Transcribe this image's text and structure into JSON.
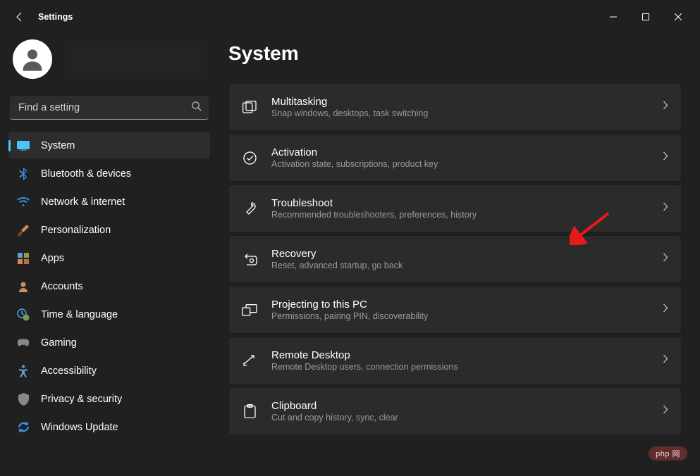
{
  "app": {
    "title": "Settings"
  },
  "search": {
    "placeholder": "Find a setting"
  },
  "page": {
    "title": "System"
  },
  "sidebar": {
    "items": [
      {
        "label": "System",
        "icon": "monitor",
        "active": true
      },
      {
        "label": "Bluetooth & devices",
        "icon": "bluetooth"
      },
      {
        "label": "Network & internet",
        "icon": "wifi"
      },
      {
        "label": "Personalization",
        "icon": "brush"
      },
      {
        "label": "Apps",
        "icon": "apps"
      },
      {
        "label": "Accounts",
        "icon": "person"
      },
      {
        "label": "Time & language",
        "icon": "clock-globe"
      },
      {
        "label": "Gaming",
        "icon": "gamepad"
      },
      {
        "label": "Accessibility",
        "icon": "accessibility"
      },
      {
        "label": "Privacy & security",
        "icon": "shield"
      },
      {
        "label": "Windows Update",
        "icon": "sync"
      }
    ]
  },
  "settings": [
    {
      "title": "Multitasking",
      "sub": "Snap windows, desktops, task switching",
      "icon": "multitask"
    },
    {
      "title": "Activation",
      "sub": "Activation state, subscriptions, product key",
      "icon": "check-circle"
    },
    {
      "title": "Troubleshoot",
      "sub": "Recommended troubleshooters, preferences, history",
      "icon": "wrench"
    },
    {
      "title": "Recovery",
      "sub": "Reset, advanced startup, go back",
      "icon": "recovery"
    },
    {
      "title": "Projecting to this PC",
      "sub": "Permissions, pairing PIN, discoverability",
      "icon": "project"
    },
    {
      "title": "Remote Desktop",
      "sub": "Remote Desktop users, connection permissions",
      "icon": "remote"
    },
    {
      "title": "Clipboard",
      "sub": "Cut and copy history, sync, clear",
      "icon": "clipboard"
    }
  ],
  "watermark": "php  网"
}
